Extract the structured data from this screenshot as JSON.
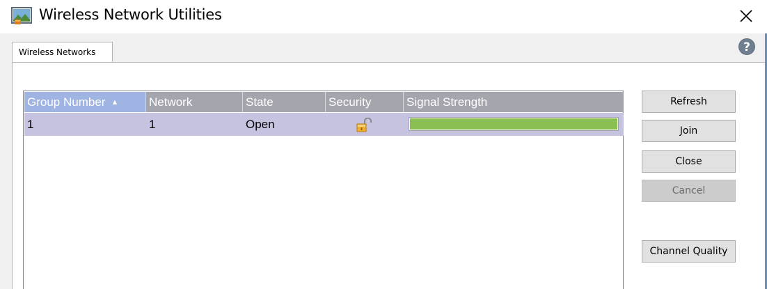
{
  "window": {
    "title": "Wireless Network Utilities",
    "icon": "wireless-utility-app-icon",
    "accent": "#6b8fb8"
  },
  "tabs": [
    {
      "label": "Wireless Networks",
      "active": true
    }
  ],
  "table": {
    "columns": [
      "Group Number",
      "Network",
      "State",
      "Security",
      "Signal Strength"
    ],
    "sort": {
      "column": "Group Number",
      "direction": "ascending",
      "indicator": "▲"
    },
    "header_color": "#a5a5ad",
    "sorted_header_color": "#9fb4e3",
    "selected_row_color": "#c6c3e0",
    "rows": [
      {
        "group_number": "1",
        "network": "1",
        "state": "Open",
        "security_icon": "open-padlock-icon",
        "signal_strength": 1.0,
        "signal_color": "#8ac052"
      }
    ]
  },
  "buttons": {
    "refresh": "Refresh",
    "join": "Join",
    "close": "Close",
    "cancel": "Cancel",
    "channel_quality": "Channel Quality"
  },
  "icons": {
    "help": "help-icon",
    "close": "close-icon"
  }
}
